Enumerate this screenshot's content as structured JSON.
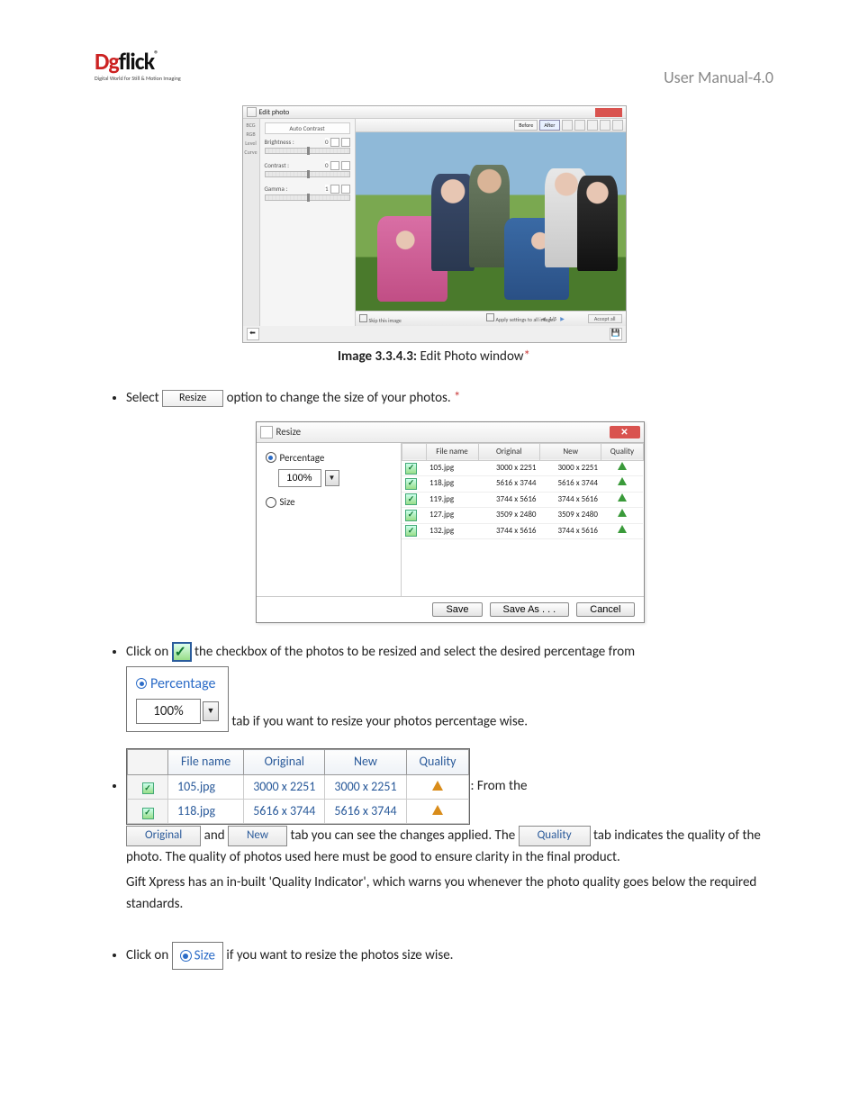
{
  "header": {
    "logo_text_d": "Dg",
    "logo_text_rest": "flick",
    "logo_tagline": "Digital World for Still & Motion Imaging",
    "manual_title": "User Manual-4.0"
  },
  "edit_photo_window": {
    "title": "Edit photo",
    "side_tabs": [
      "BCG",
      "RGB",
      "Level",
      "Curve"
    ],
    "panel_title": "Auto Contrast",
    "sliders": [
      {
        "label": "Brightness :",
        "value": "0"
      },
      {
        "label": "Contrast :",
        "value": "0"
      },
      {
        "label": "Gamma :",
        "value": "1"
      }
    ],
    "toolbar": {
      "before": "Before",
      "after": "After"
    },
    "bottom": {
      "skip": "Skip this image",
      "apply_all": "Apply settings to all images",
      "pager": "1/5",
      "accept_all": "Accept all"
    }
  },
  "caption1": {
    "bold": "Image 3.3.4.3:",
    "rest": " Edit Photo window"
  },
  "bullet1": {
    "pre": "Select ",
    "chip": "Resize",
    "post": " option to change the size of your photos.  "
  },
  "resize_dialog": {
    "title": "Resize",
    "percentage_label": "Percentage",
    "percentage_value": "100%",
    "size_label": "Size",
    "columns": {
      "file": "File name",
      "original": "Original",
      "new": "New",
      "quality": "Quality"
    },
    "rows": [
      {
        "file": "105.jpg",
        "original": "3000 x 2251",
        "new": "3000 x 2251"
      },
      {
        "file": "118.jpg",
        "original": "5616 x 3744",
        "new": "5616 x 3744"
      },
      {
        "file": "119.jpg",
        "original": "3744 x 5616",
        "new": "3744 x 5616"
      },
      {
        "file": "127.jpg",
        "original": "3509 x 2480",
        "new": "3509 x 2480"
      },
      {
        "file": "132.jpg",
        "original": "3744 x 5616",
        "new": "3744 x 5616"
      }
    ],
    "buttons": {
      "save": "Save",
      "save_as": "Save As . . .",
      "cancel": "Cancel"
    }
  },
  "bullet2": {
    "pre": "Click on ",
    "post_a": " the checkbox of the photos to be resized and select the desired percentage from",
    "pct_label": "Percentage",
    "pct_value": "100%",
    "post_b": " tab if you want to resize your photos percentage wise."
  },
  "bullet3": {
    "inline_table": {
      "headers": {
        "file": "File name",
        "original": "Original",
        "new": "New",
        "quality": "Quality"
      },
      "rows": [
        {
          "file": "105.jpg",
          "original": "3000 x 2251",
          "new": "3000 x 2251"
        },
        {
          "file": "118.jpg",
          "original": "5616 x 3744",
          "new": "5616 x 3744"
        }
      ]
    },
    "text_from_the": ": From the ",
    "tab_original": "Original",
    "text_and": " and ",
    "tab_new": "New",
    "text_mid": " tab you can see the changes applied. The ",
    "tab_quality": "Quality",
    "text_end1": " tab indicates the quality of the photo. The quality of photos used here must be good to ensure clarity in the final product.",
    "text_end2": "Gift Xpress has an in-built 'Quality Indicator', which warns you whenever the photo quality goes below the required standards."
  },
  "bullet4": {
    "pre": "Click on ",
    "size_label": "Size",
    "post": " if you want to resize the photos size wise."
  }
}
